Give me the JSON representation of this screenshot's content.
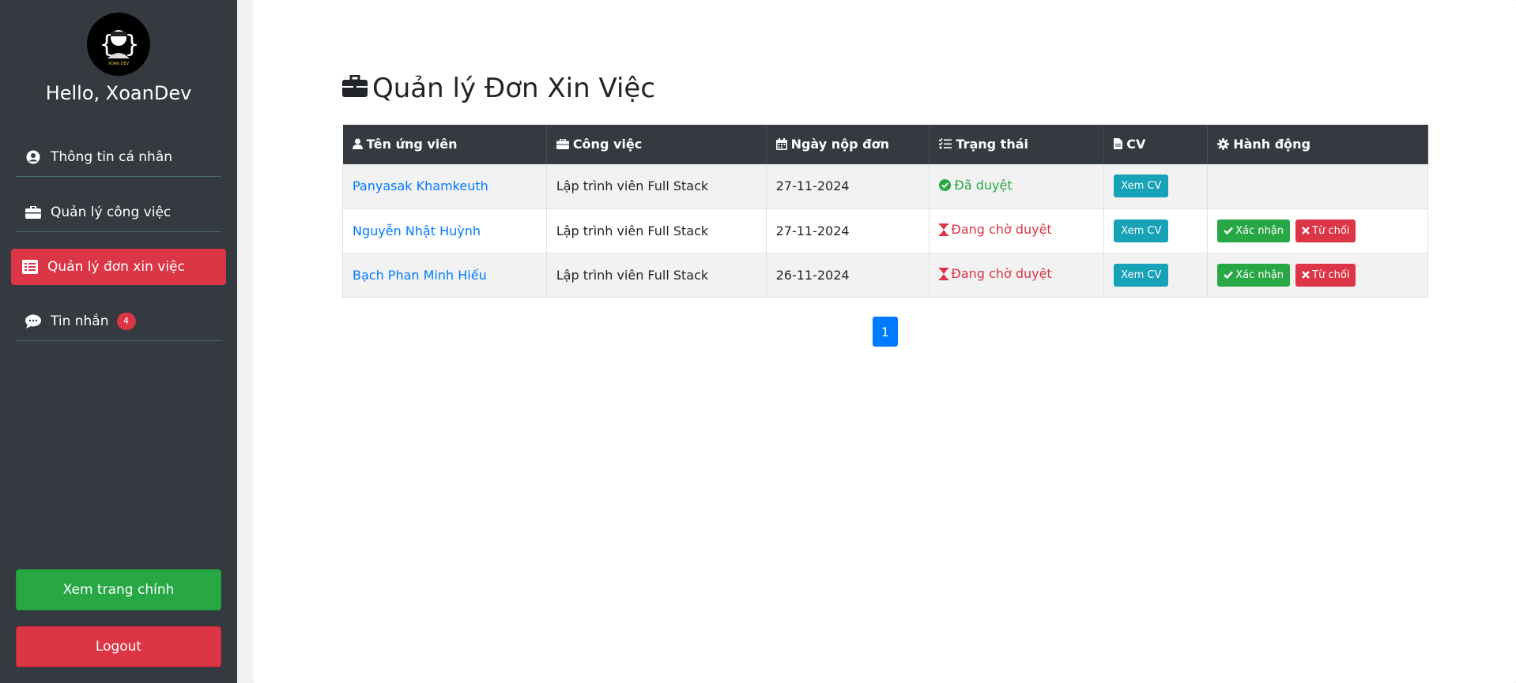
{
  "sidebar": {
    "avatar_text": "XOAN DEV",
    "greeting": "Hello, XoanDev",
    "items": [
      {
        "label": "Thông tin cá nhân",
        "icon": "user-circle-icon"
      },
      {
        "label": "Quản lý công việc",
        "icon": "briefcase-icon"
      },
      {
        "label": "Quản lý đơn xin việc",
        "icon": "list-icon"
      },
      {
        "label": "Tin nhắn",
        "icon": "chat-icon",
        "badge": "4"
      }
    ],
    "view_main_label": "Xem trang chính",
    "logout_label": "Logout"
  },
  "main": {
    "title": "Quản lý Đơn Xin Việc",
    "columns": [
      "Tên ứng viên",
      "Công việc",
      "Ngày nộp đơn",
      "Trạng thái",
      "CV",
      "Hành động"
    ],
    "rows": [
      {
        "name": "Panyasak Khamkeuth",
        "job": "Lập trình viên Full Stack",
        "date": "27-11-2024",
        "status": "Đã duyệt",
        "cv": "Xem CV"
      },
      {
        "name": "Nguyễn Nhật Huỳnh",
        "job": "Lập trình viên Full Stack",
        "date": "27-11-2024",
        "status": "Đang chờ duyệt",
        "cv": "Xem CV",
        "accept": "Xác nhận",
        "reject": "Từ chối"
      },
      {
        "name": "Bạch Phan Minh Hiếu",
        "job": "Lập trình viên Full Stack",
        "date": "26-11-2024",
        "status": "Đang chờ duyệt",
        "cv": "Xem CV",
        "accept": "Xác nhận",
        "reject": "Từ chối"
      }
    ],
    "pagination": {
      "current": "1"
    }
  },
  "colors": {
    "sidebar": "#343a40",
    "active": "#dc3545",
    "success": "#28a745",
    "info": "#17a2b8",
    "primary": "#007bff"
  }
}
